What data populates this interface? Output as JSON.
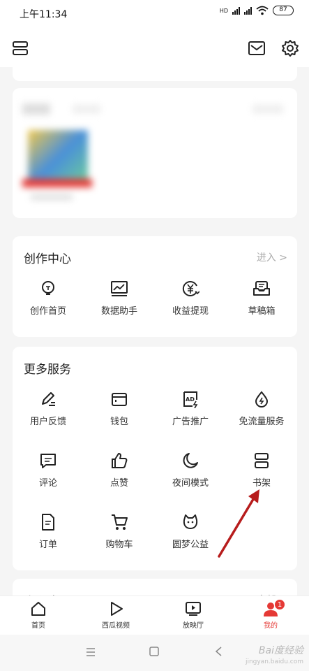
{
  "status": {
    "time": "上午11:34",
    "battery": "87",
    "network": "HD"
  },
  "creation_center": {
    "title": "创作中心",
    "enter": "进入 >",
    "items": [
      {
        "label": "创作首页",
        "icon": "bulb-icon"
      },
      {
        "label": "数据助手",
        "icon": "chart-icon"
      },
      {
        "label": "收益提现",
        "icon": "yen-icon"
      },
      {
        "label": "草稿箱",
        "icon": "draft-icon"
      }
    ]
  },
  "more_services": {
    "title": "更多服务",
    "items": [
      {
        "label": "用户反馈",
        "icon": "feedback-icon"
      },
      {
        "label": "钱包",
        "icon": "wallet-icon"
      },
      {
        "label": "广告推广",
        "icon": "ad-icon"
      },
      {
        "label": "免流量服务",
        "icon": "drop-icon"
      },
      {
        "label": "评论",
        "icon": "comment-icon"
      },
      {
        "label": "点赞",
        "icon": "like-icon"
      },
      {
        "label": "夜间模式",
        "icon": "moon-icon"
      },
      {
        "label": "书架",
        "icon": "bookshelf-icon"
      },
      {
        "label": "订单",
        "icon": "order-icon"
      },
      {
        "label": "购物车",
        "icon": "cart-icon"
      },
      {
        "label": "圆梦公益",
        "icon": "charity-icon"
      }
    ]
  },
  "mini_programs": {
    "title": "小程序",
    "link": "全部 >"
  },
  "tabs": [
    {
      "label": "首页",
      "icon": "home-icon"
    },
    {
      "label": "西瓜视频",
      "icon": "play-icon"
    },
    {
      "label": "放映厅",
      "icon": "screen-icon"
    },
    {
      "label": "我的",
      "icon": "user-icon",
      "badge": "1",
      "active": true
    }
  ],
  "watermark": {
    "text": "Bai度经验",
    "sub": "jingyan.baidu.com"
  },
  "colors": {
    "accent": "#e53935",
    "arrow": "#b71c1c"
  }
}
